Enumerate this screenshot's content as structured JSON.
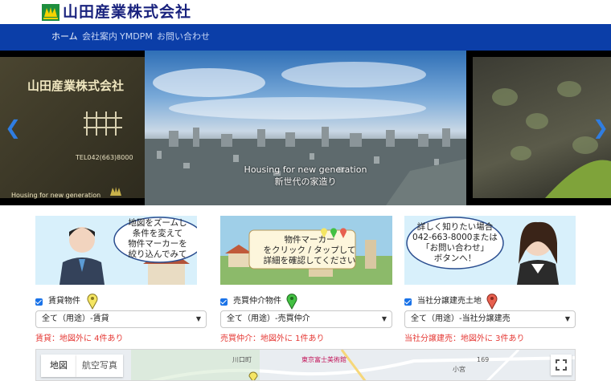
{
  "header": {
    "company_name": "山田産業株式会社",
    "nav": [
      {
        "label": "ホーム",
        "active": true
      },
      {
        "label": "会社案内",
        "active": false
      },
      {
        "label": "YMDPM",
        "active": false
      },
      {
        "label": "お問い合わせ",
        "active": false
      }
    ]
  },
  "carousel": {
    "prev_glyph": "❮",
    "next_glyph": "❯",
    "left_slide": {
      "title": "山田産業株式会社",
      "tel": "TEL042(663)8000",
      "slogan": "Housing for new generation"
    },
    "caption_en": "Housing for new generation",
    "caption_ja": "新世代の家造り"
  },
  "panels": [
    {
      "lines": [
        "地図をズームし",
        "条件を変えて",
        "物件マーカーを",
        "絞り込んでみて"
      ]
    },
    {
      "lines": [
        "物件マーカー",
        "をクリック / タップして",
        "詳細を確認してください"
      ]
    },
    {
      "lines": [
        "詳しく知りたい場合",
        "042-663-8000または",
        "「お問い合わせ」",
        "ボタンへ！"
      ]
    }
  ],
  "filters": [
    {
      "label": "賃貸物件",
      "checked": true,
      "pin_color": "#f5e663",
      "select_value": "全て（用途）-賃貸",
      "count_text": "賃貸：地図外に 4件あり"
    },
    {
      "label": "売買仲介物件",
      "checked": true,
      "pin_color": "#43c143",
      "select_value": "全て（用途）-売買仲介",
      "count_text": "売買仲介：地図外に 1件あり"
    },
    {
      "label": "当社分譲建売土地",
      "checked": true,
      "pin_color": "#e8604f",
      "select_value": "全て（用途）-当社分譲建売",
      "count_text": "当社分譲建売：地図外に 3件あり"
    }
  ],
  "map": {
    "tabs": [
      {
        "label": "地図",
        "active": true
      },
      {
        "label": "航空写真",
        "active": false
      }
    ],
    "labels": [
      "川口町",
      "東京富士美術館",
      "小宮",
      "169"
    ]
  },
  "colors": {
    "nav_bg": "#0b3ea8",
    "logo_text": "#1a237e",
    "count_text": "#e53935",
    "arrow": "#2f7de1"
  }
}
